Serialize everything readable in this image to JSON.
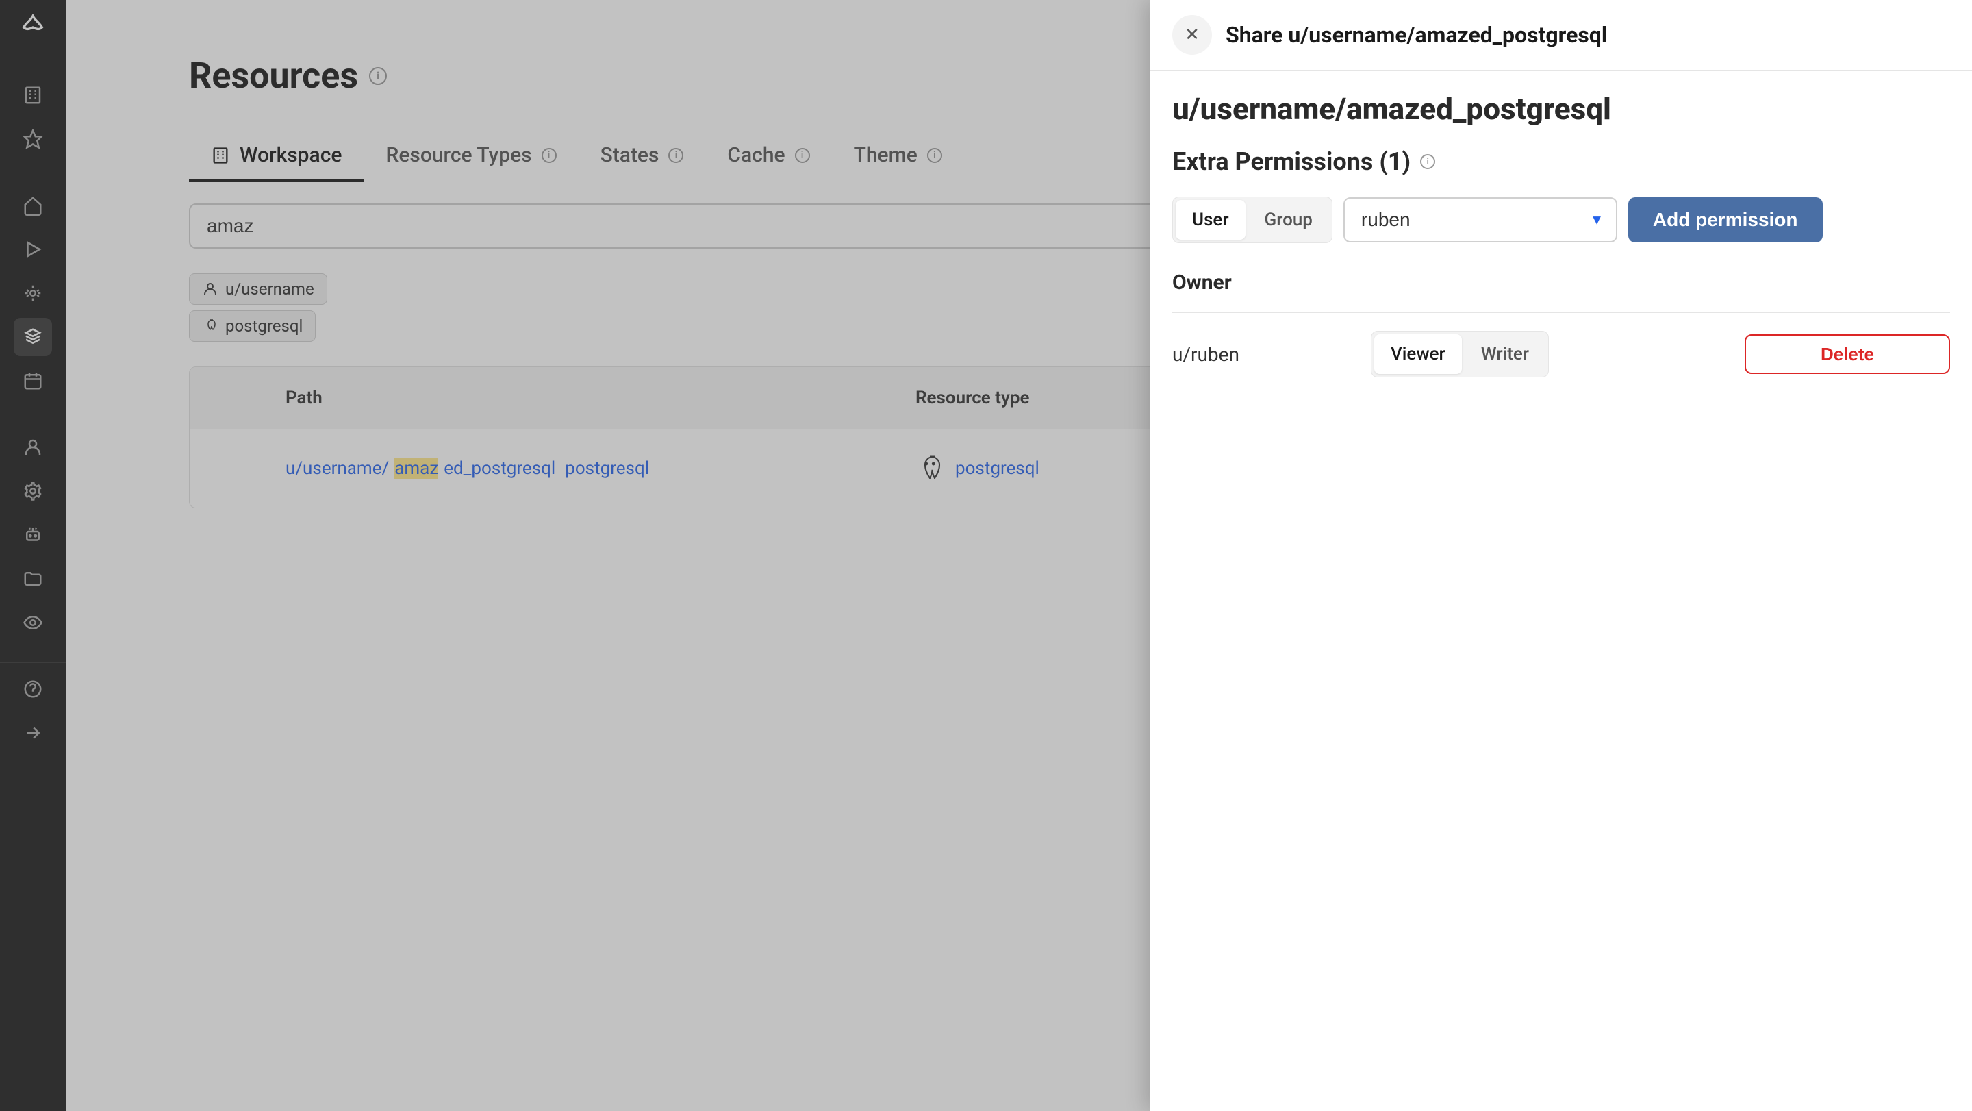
{
  "page": {
    "title": "Resources"
  },
  "tabs": {
    "workspace": "Workspace",
    "resource_types": "Resource Types",
    "states": "States",
    "cache": "Cache",
    "theme": "Theme"
  },
  "search": {
    "value": "amaz"
  },
  "filters": {
    "user": "u/username",
    "type": "postgresql"
  },
  "table": {
    "headers": {
      "path": "Path",
      "type": "Resource type"
    },
    "rows": [
      {
        "path_prefix": "u/username/",
        "path_highlight": "amaz",
        "path_suffix": "ed_postgresql",
        "path_type_suffix": "postgresql",
        "type": "postgresql"
      }
    ]
  },
  "panel": {
    "title": "Share u/username/amazed_postgresql",
    "resource_path": "u/username/amazed_postgresql",
    "section_title": "Extra Permissions (1)",
    "tabs": {
      "user": "User",
      "group": "Group"
    },
    "select_value": "ruben",
    "add_button": "Add permission",
    "owner_label": "Owner",
    "permissions": [
      {
        "user": "u/ruben",
        "role_viewer": "Viewer",
        "role_writer": "Writer",
        "delete": "Delete"
      }
    ]
  },
  "icons": {
    "info": "i",
    "close": "✕"
  }
}
